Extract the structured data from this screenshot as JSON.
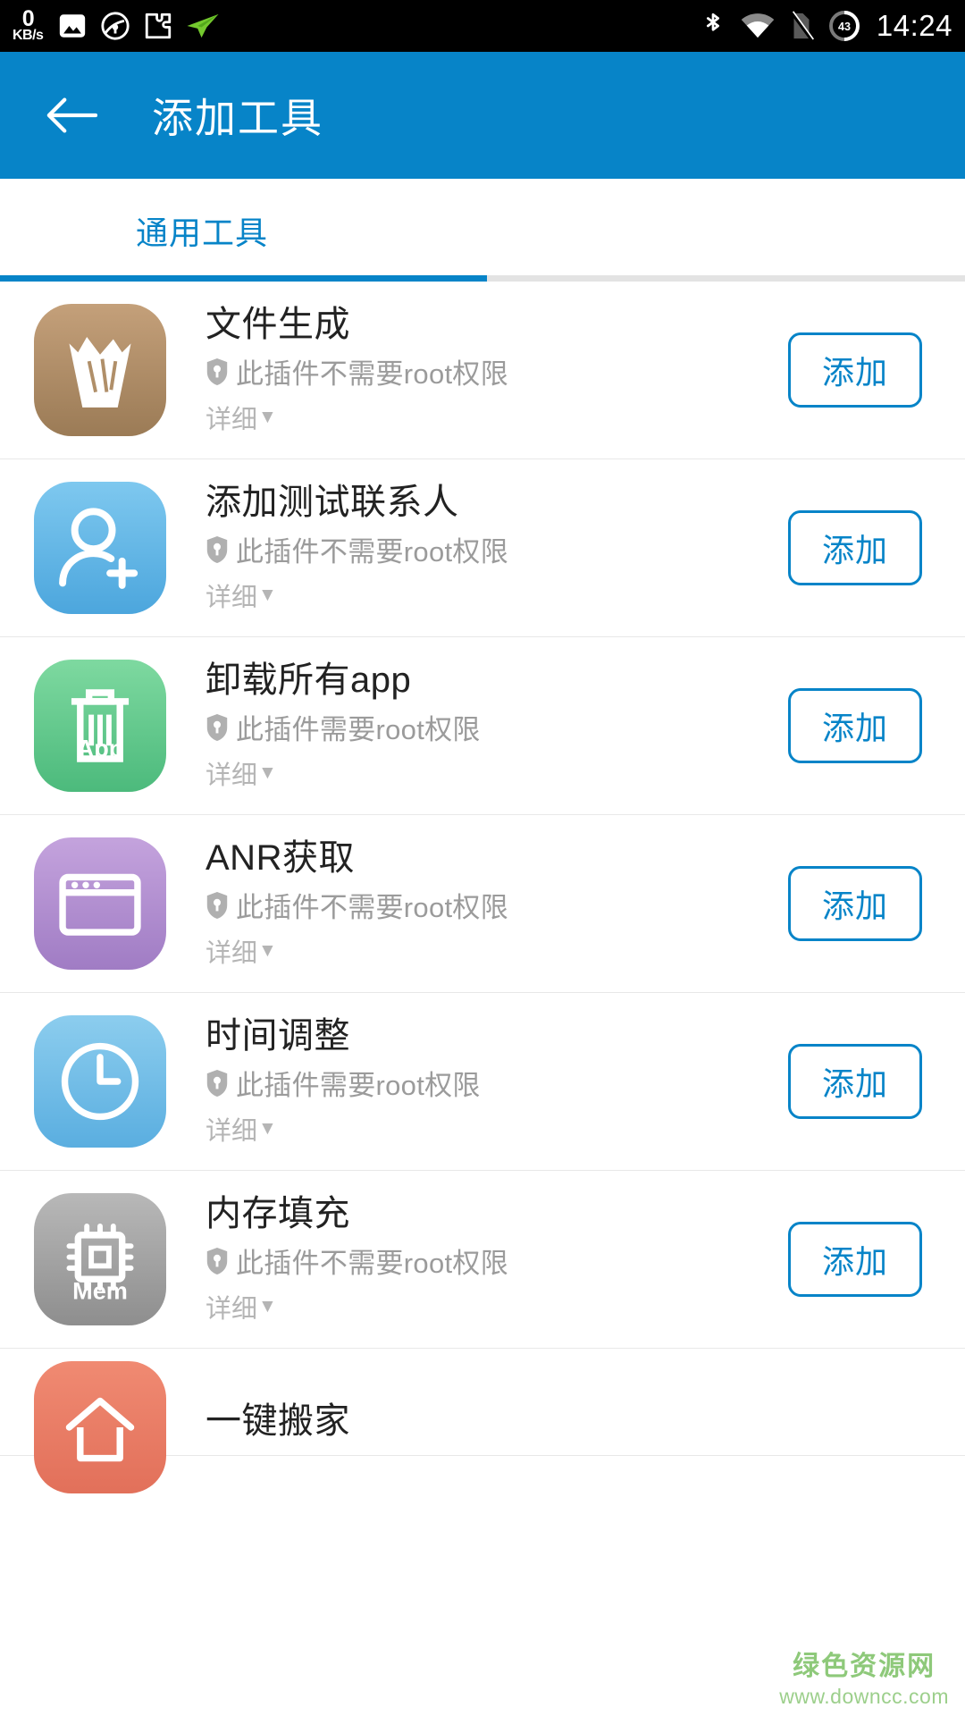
{
  "status_bar": {
    "net_speed_value": "0",
    "net_speed_unit": "KB/s",
    "time": "14:24",
    "battery_level": "43",
    "left_icons": [
      "gallery-icon",
      "browser-icon",
      "puzzle-icon",
      "paperplane-icon"
    ],
    "right_icons": [
      "bluetooth-icon",
      "wifi-icon",
      "no-sim-icon",
      "battery-icon"
    ]
  },
  "app_bar": {
    "back_label": "←",
    "title": "添加工具"
  },
  "tabs": [
    {
      "label": "通用工具",
      "selected": true
    }
  ],
  "colors": {
    "primary": "#0784c8",
    "status_bar_bg": "#000000",
    "subtitle": "#9b9b9b",
    "watermark": "#8ec97a"
  },
  "list": {
    "detail_label": "详细",
    "detail_caret": "▼",
    "add_label": "添加",
    "items": [
      {
        "title": "文件生成",
        "permission": "此插件不需要root权限",
        "detail": "详细",
        "add": "添加",
        "icon_name": "file-generate-icon",
        "icon_color_top": "#c4a07a",
        "icon_color_bottom": "#9b7b56"
      },
      {
        "title": "添加测试联系人",
        "permission": "此插件不需要root权限",
        "detail": "详细",
        "add": "添加",
        "icon_name": "add-contact-icon",
        "icon_color_top": "#7ec8ef",
        "icon_color_bottom": "#4ca6dd"
      },
      {
        "title": "卸载所有app",
        "permission": "此插件需要root权限",
        "detail": "详细",
        "add": "添加",
        "icon_name": "uninstall-all-apps-icon",
        "icon_color_top": "#7ed9a0",
        "icon_color_bottom": "#4cba7c"
      },
      {
        "title": "ANR获取",
        "permission": "此插件不需要root权限",
        "detail": "详细",
        "add": "添加",
        "icon_name": "anr-capture-icon",
        "icon_color_top": "#c4a3dd",
        "icon_color_bottom": "#a07cc4"
      },
      {
        "title": "时间调整",
        "permission": "此插件需要root权限",
        "detail": "详细",
        "add": "添加",
        "icon_name": "time-adjust-icon",
        "icon_color_top": "#8ccdee",
        "icon_color_bottom": "#5aaee0"
      },
      {
        "title": "内存填充",
        "permission": "此插件不需要root权限",
        "detail": "详细",
        "add": "添加",
        "icon_name": "memory-fill-icon",
        "icon_color_top": "#b8b8b8",
        "icon_color_bottom": "#8e8e8e"
      },
      {
        "title": "一键搬家",
        "permission": "",
        "detail": "",
        "add": "",
        "icon_name": "one-key-move-icon",
        "icon_color_top": "#f08a72",
        "icon_color_bottom": "#e2705a"
      }
    ]
  },
  "watermark": {
    "name": "绿色资源网",
    "url": "www.downcc.com"
  }
}
